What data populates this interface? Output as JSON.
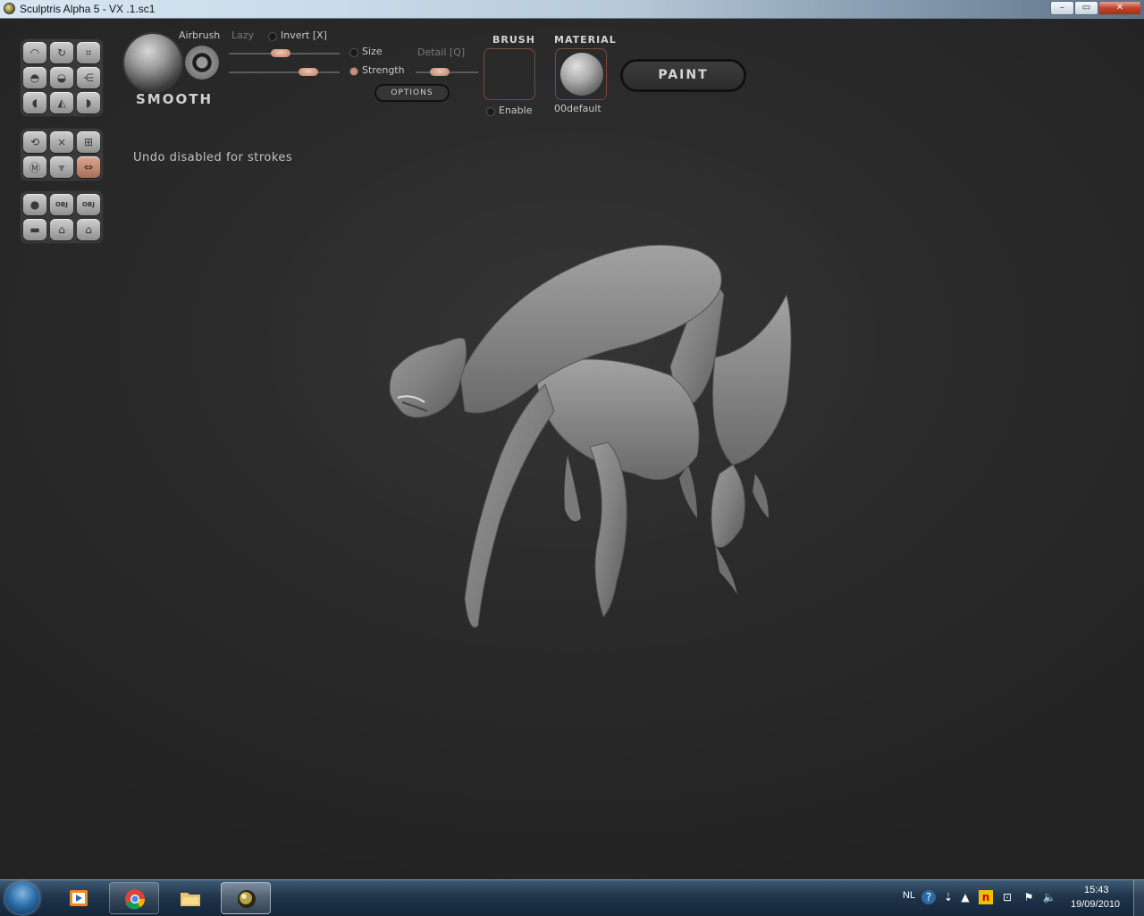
{
  "window": {
    "title": "Sculptris Alpha 5 - VX .1.sc1",
    "min_symbol": "–",
    "max_symbol": "▭",
    "close_symbol": "✕"
  },
  "brush_panel": {
    "brush_name": "SMOOTH",
    "airbrush_label": "Airbrush",
    "lazy_label": "Lazy",
    "invert_label": "Invert [X]",
    "size_label": "Size",
    "detail_label": "Detail [Q]",
    "strength_label": "Strength",
    "options_label": "OPTIONS",
    "size_value_fraction": 0.47,
    "strength_value_fraction": 0.72,
    "detail_value_fraction": 0.38
  },
  "brush_section": {
    "heading": "BRUSH",
    "enable_label": "Enable"
  },
  "material_section": {
    "heading": "MATERIAL",
    "material_name": "00default"
  },
  "paint_button": {
    "label": "PAINT"
  },
  "status_message": "Undo disabled for strokes",
  "tools": {
    "group1": [
      {
        "name": "draw-tool",
        "glyph": "◠"
      },
      {
        "name": "rotate-tool",
        "glyph": "↻"
      },
      {
        "name": "scale-tool",
        "glyph": "⌗"
      },
      {
        "name": "flatten-tool",
        "glyph": "◓"
      },
      {
        "name": "inflate-tool",
        "glyph": "◒"
      },
      {
        "name": "pinch-tool",
        "glyph": "⋲"
      },
      {
        "name": "crease-tool",
        "glyph": "◖"
      },
      {
        "name": "grab-tool",
        "glyph": "◭"
      },
      {
        "name": "smooth-tool",
        "glyph": "◗"
      }
    ],
    "group2": [
      {
        "name": "symmetry-tool",
        "glyph": "⟲"
      },
      {
        "name": "wireframe-tool",
        "glyph": "⨯"
      },
      {
        "name": "grid-tool",
        "glyph": "⊞"
      },
      {
        "name": "mask-tool",
        "glyph": "Ⓜ"
      },
      {
        "name": "reduce-tool",
        "glyph": "⩔"
      },
      {
        "name": "mirror-tool",
        "glyph": "⇔"
      }
    ],
    "group3": [
      {
        "name": "sphere-tool",
        "glyph": "●"
      },
      {
        "name": "import-obj-tool",
        "glyph": "OBJ"
      },
      {
        "name": "export-obj-tool",
        "glyph": "OBJ"
      },
      {
        "name": "new-scene-tool",
        "glyph": "▬"
      },
      {
        "name": "open-file-tool",
        "glyph": "⌂"
      },
      {
        "name": "save-file-tool",
        "glyph": "⌂"
      }
    ]
  },
  "taskbar": {
    "language": "NL",
    "time": "15:43",
    "date": "19/09/2010"
  }
}
